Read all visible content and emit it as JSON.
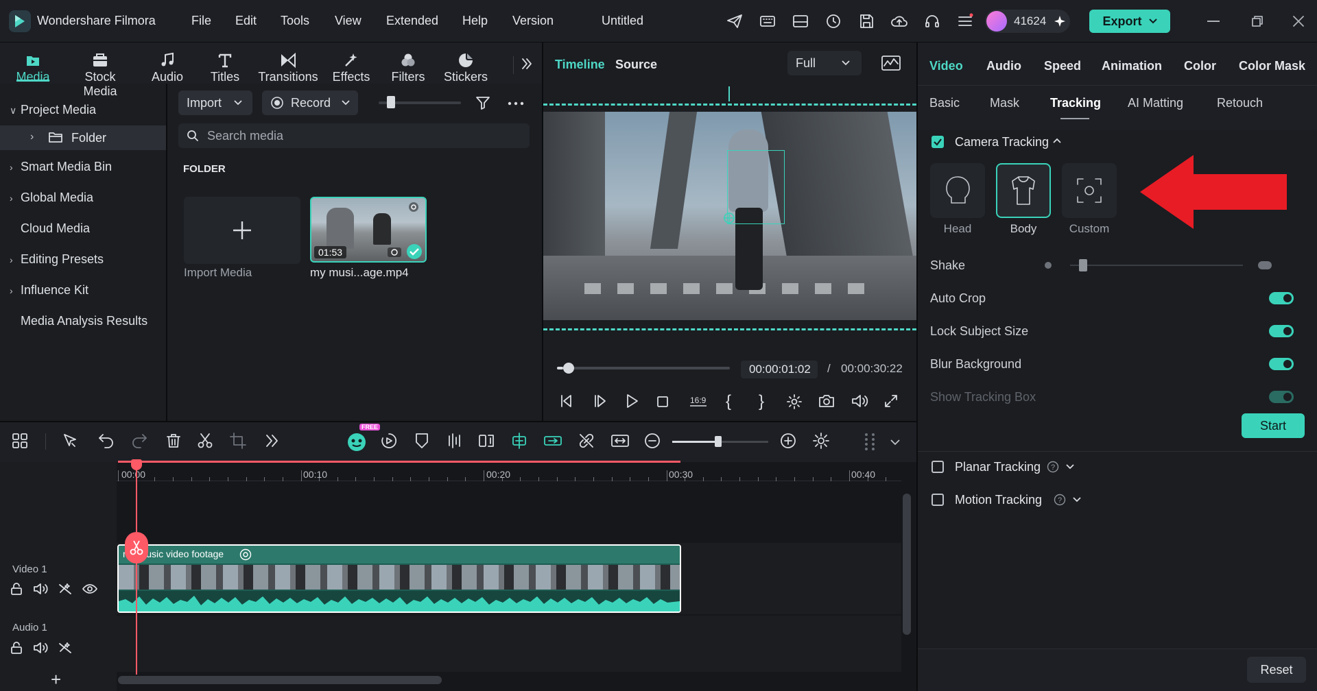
{
  "app": {
    "name": "Wondershare Filmora",
    "menu": [
      "File",
      "Edit",
      "Tools",
      "View",
      "Extended",
      "Help",
      "Version"
    ],
    "project_title": "Untitled",
    "user_credits": "41624",
    "export_label": "Export",
    "accent_color": "#3ad3ba"
  },
  "media_tabs": [
    {
      "label": "Media",
      "icon": "media-icon",
      "active": true
    },
    {
      "label": "Stock Media",
      "icon": "stock-media-icon"
    },
    {
      "label": "Audio",
      "icon": "music-note-icon"
    },
    {
      "label": "Titles",
      "icon": "titles-icon"
    },
    {
      "label": "Transitions",
      "icon": "transitions-icon"
    },
    {
      "label": "Effects",
      "icon": "effects-icon"
    },
    {
      "label": "Filters",
      "icon": "filters-icon"
    },
    {
      "label": "Stickers",
      "icon": "stickers-icon"
    }
  ],
  "sidebar": {
    "items": [
      {
        "label": "Project Media",
        "expanded": true
      },
      {
        "label": "Folder",
        "selected": true
      },
      {
        "label": "Smart Media Bin"
      },
      {
        "label": "Global Media"
      },
      {
        "label": "Cloud Media"
      },
      {
        "label": "Editing Presets"
      },
      {
        "label": "Influence Kit"
      },
      {
        "label": "Media Analysis Results"
      }
    ]
  },
  "media_panel": {
    "import_label": "Import",
    "record_label": "Record",
    "search_placeholder": "Search media",
    "folder_heading": "FOLDER",
    "import_tile_label": "Import Media",
    "clip": {
      "name": "my musi...age.mp4",
      "duration": "01:53"
    }
  },
  "preview": {
    "tab_timeline": "Timeline",
    "tab_source": "Source",
    "quality": "Full",
    "current_time": "00:00:01:02",
    "separator": "/",
    "total_time": "00:00:30:22",
    "progress_fraction": 0.034
  },
  "properties": {
    "tabs": [
      "Video",
      "Audio",
      "Speed",
      "Animation",
      "Color",
      "Color Mask"
    ],
    "subtabs": [
      "Basic",
      "Mask",
      "Tracking",
      "AI Matting",
      "Retouch"
    ],
    "active_tab": "Video",
    "active_subtab": "Tracking",
    "camera_tracking": {
      "label": "Camera Tracking",
      "enabled": true,
      "modes": [
        {
          "label": "Head",
          "icon": "head-icon"
        },
        {
          "label": "Body",
          "icon": "body-icon",
          "selected": true
        },
        {
          "label": "Custom",
          "icon": "custom-focus-icon"
        }
      ],
      "shake_label": "Shake",
      "shake_level": 0.05,
      "options": [
        {
          "label": "Auto Crop",
          "on": true
        },
        {
          "label": "Lock Subject Size",
          "on": true
        },
        {
          "label": "Blur Background",
          "on": true
        },
        {
          "label": "Show Tracking Box",
          "on": true,
          "disabled": true
        }
      ],
      "start_label": "Start"
    },
    "planar_tracking": {
      "label": "Planar Tracking",
      "enabled": false
    },
    "motion_tracking": {
      "label": "Motion Tracking",
      "enabled": false
    },
    "reset_label": "Reset"
  },
  "timeline": {
    "ruler": [
      "00:00",
      "00:10",
      "00:20",
      "00:30",
      "00:40"
    ],
    "tracks": [
      {
        "label": "Video 1"
      },
      {
        "label": "Audio 1"
      }
    ],
    "clip_title": "my music video footage",
    "free_badge": "FREE",
    "add_track_label": "+"
  }
}
